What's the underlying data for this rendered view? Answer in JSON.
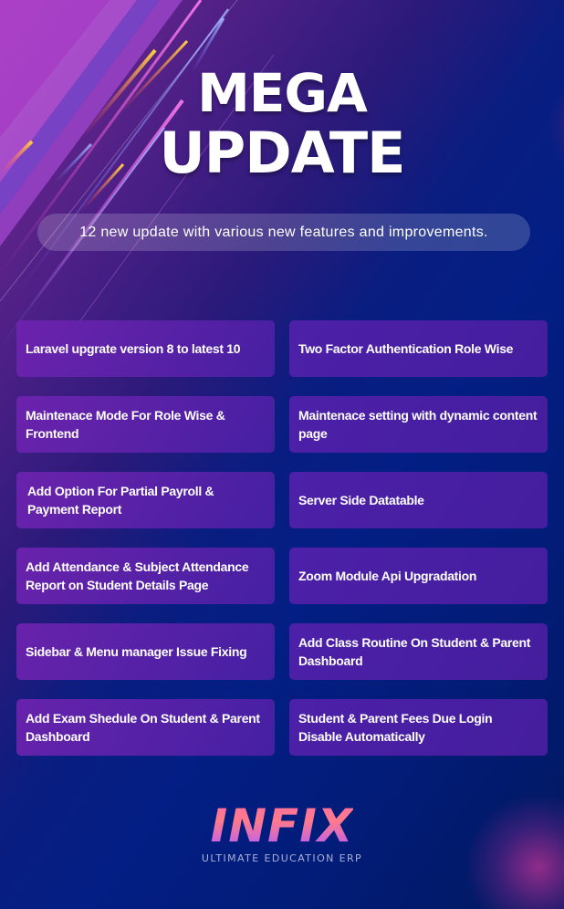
{
  "header": {
    "title_line1": "MEGA",
    "title_line2": "UPDATE",
    "subtitle": "12 new update with various new features and improvements."
  },
  "features": [
    "Laravel upgrate version 8 to latest 10",
    "Two Factor Authentication Role Wise",
    "Maintenace Mode For Role Wise & Frontend",
    "Maintenace setting with dynamic content page",
    "Add Option For Partial Payroll & Payment Report",
    "Server Side Datatable",
    "Add Attendance & Subject Attendance Report on Student Details Page",
    "Zoom Module Api Upgradation",
    "Sidebar & Menu manager Issue Fixing",
    "Add Class Routine On Student & Parent Dashboard",
    "Add Exam Shedule On Student & Parent Dashboard",
    "Student & Parent Fees Due Login Disable Automatically"
  ],
  "brand": {
    "logo_text": "INFIX",
    "tagline": "ULTIMATE EDUCATION ERP"
  },
  "colors": {
    "background": "#021c78",
    "card": "#5520a8",
    "accent_pink": "#ff6fa0",
    "accent_purple": "#b25cff"
  }
}
